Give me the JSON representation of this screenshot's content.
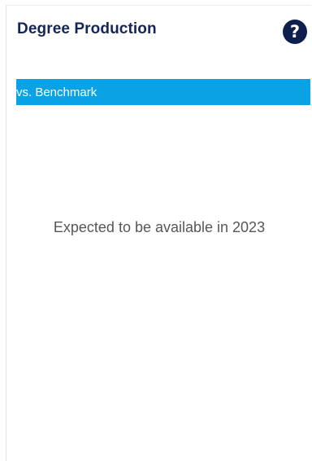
{
  "panel": {
    "title": "Degree Production",
    "help_icon": {
      "name": "help-icon",
      "glyph": "?"
    },
    "benchmark_tab": {
      "label": "vs. Benchmark",
      "color": "#0aa2e4"
    },
    "message": "Expected to be available in 2023"
  },
  "colors": {
    "title": "#14255a",
    "icon_background": "#0e1f4d",
    "message_text": "#575757"
  }
}
